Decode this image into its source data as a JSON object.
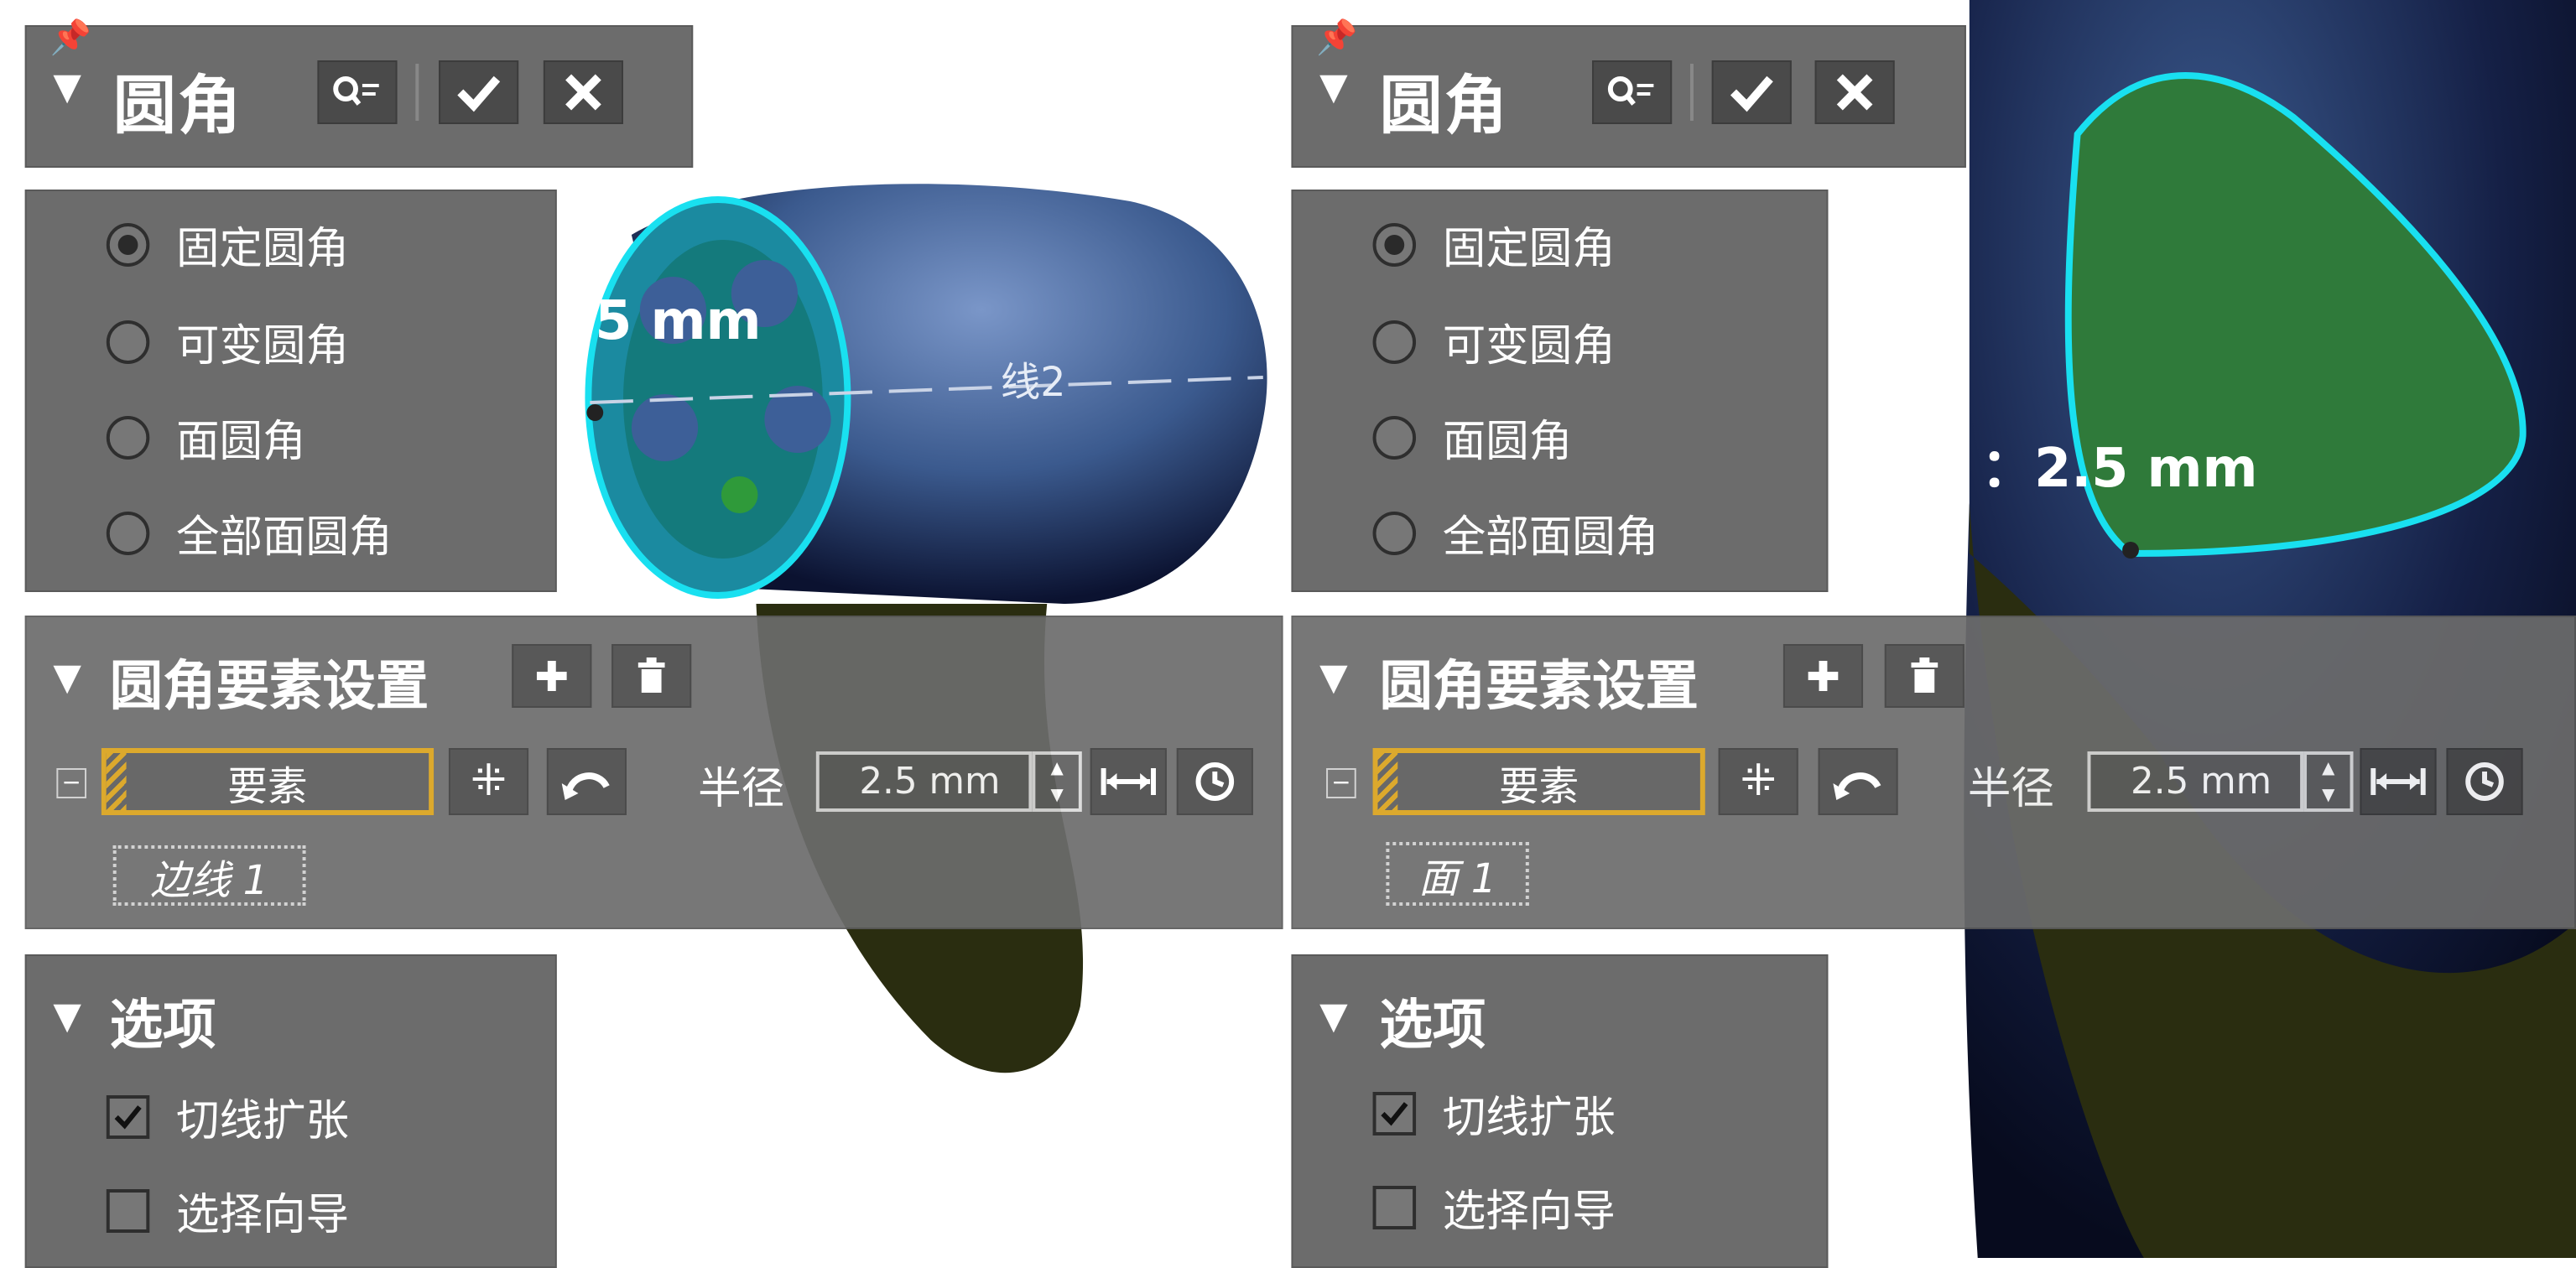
{
  "left": {
    "title": "圆角",
    "fillet_types": [
      "固定圆角",
      "可变圆角",
      "面圆角",
      "全部面圆角"
    ],
    "selected_type_index": 0,
    "element_section": {
      "title": "圆角要素设置",
      "element_button": "要素",
      "radius_label": "半径",
      "radius_value": "2.5 mm",
      "selected_item": "边线 1"
    },
    "options_section": {
      "title": "选项",
      "options": [
        {
          "label": "切线扩张",
          "checked": true
        },
        {
          "label": "选择向导",
          "checked": false
        }
      ]
    },
    "viewport": {
      "dimension_label": "5 mm",
      "line_label": "线2"
    }
  },
  "right": {
    "title": "圆角",
    "fillet_types": [
      "固定圆角",
      "可变圆角",
      "面圆角",
      "全部面圆角"
    ],
    "selected_type_index": 0,
    "element_section": {
      "title": "圆角要素设置",
      "element_button": "要素",
      "radius_label": "半径",
      "radius_value": "2.5 mm",
      "selected_item": "面 1"
    },
    "options_section": {
      "title": "选项",
      "options": [
        {
          "label": "切线扩张",
          "checked": true
        },
        {
          "label": "选择向导",
          "checked": false
        }
      ]
    },
    "viewport": {
      "dimension_label": "：2.5 mm"
    }
  },
  "icons": {
    "pin": "pin-icon",
    "preview": "preview-search-icon",
    "ok": "check-icon",
    "cancel": "close-icon",
    "add": "plus-icon",
    "delete": "trash-icon",
    "multi_select": "multi-select-icon",
    "undo": "undo-icon",
    "measure": "measure-icon",
    "history": "history-icon"
  },
  "colors": {
    "panel_bg": "#6c6c6c",
    "button_bg": "#4a4a4a",
    "element_highlight": "#d9a21c",
    "selection_cyan": "#19e0f0",
    "model_blue": "#3a5a8c",
    "fill_green": "#2f7a3a"
  }
}
